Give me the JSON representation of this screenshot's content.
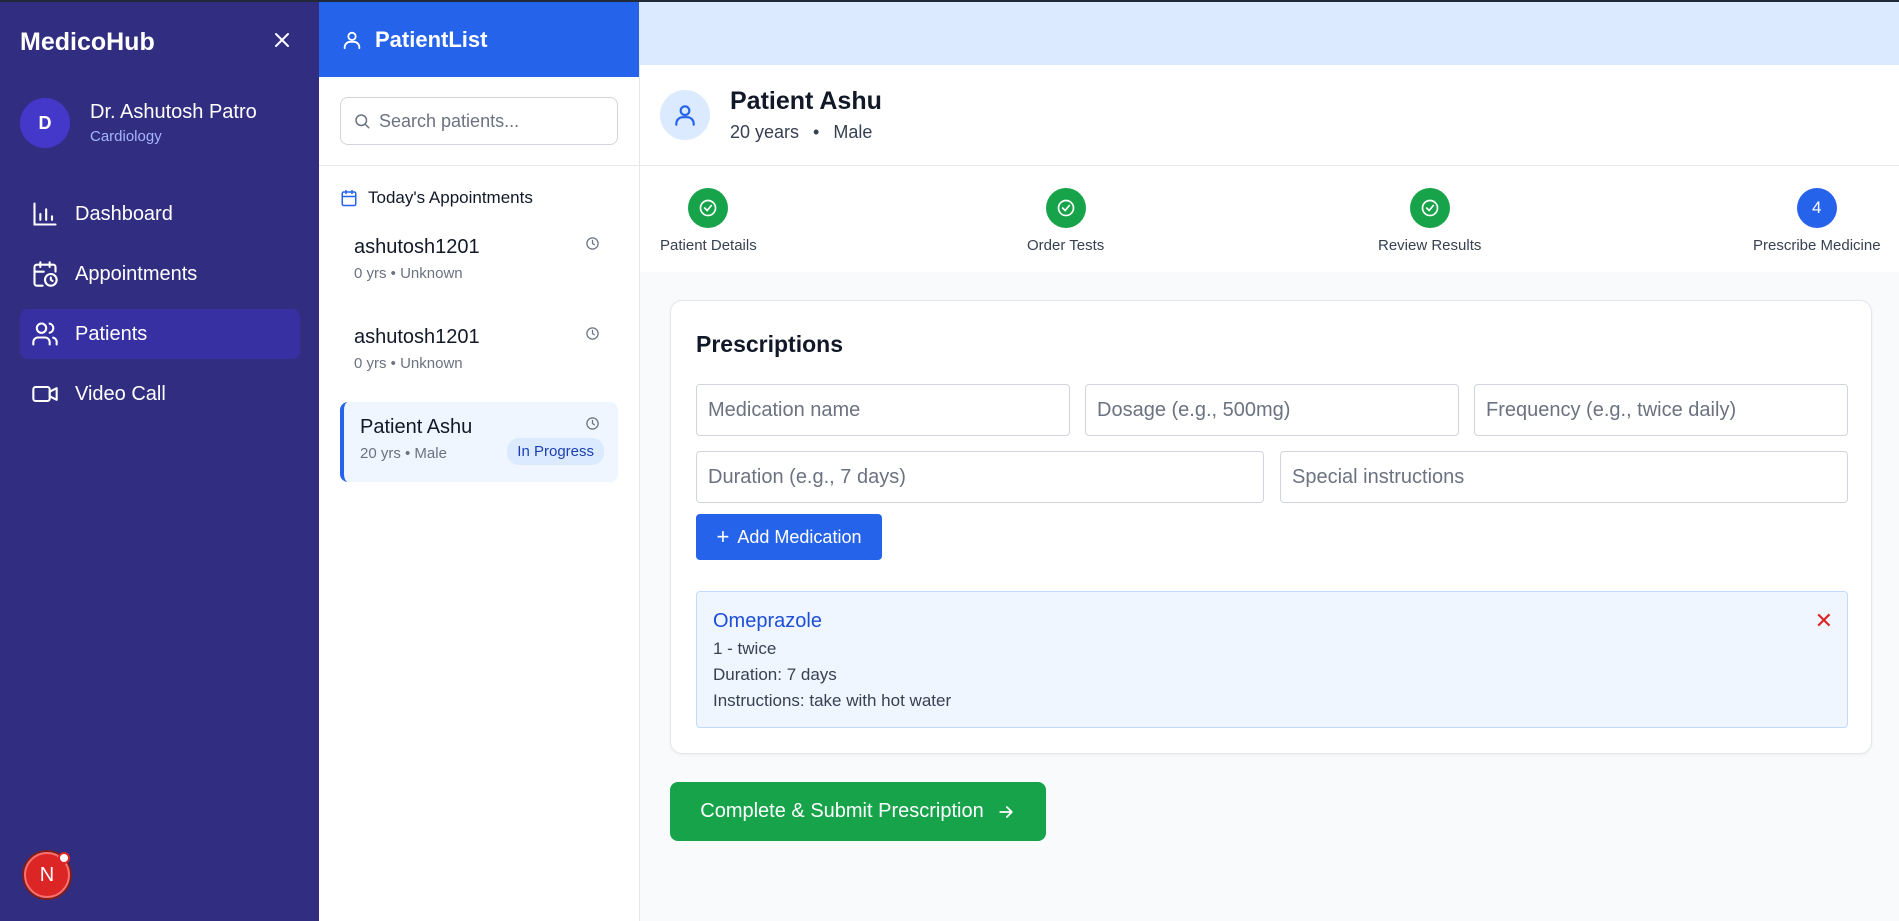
{
  "app": {
    "brand": "MedicoHub"
  },
  "profile": {
    "initial": "D",
    "name": "Dr. Ashutosh Patro",
    "department": "Cardiology"
  },
  "nav": [
    {
      "label": "Dashboard",
      "icon": "bar-chart-icon",
      "active": false
    },
    {
      "label": "Appointments",
      "icon": "calendar-clock-icon",
      "active": false
    },
    {
      "label": "Patients",
      "icon": "users-icon",
      "active": true
    },
    {
      "label": "Video Call",
      "icon": "video-icon",
      "active": false
    }
  ],
  "notification_badge": {
    "letter": "N"
  },
  "patient_list": {
    "title": "PatientList",
    "search_placeholder": "Search patients...",
    "appointments_heading": "Today's Appointments",
    "patients": [
      {
        "name": "ashutosh1201",
        "meta": "0 yrs • Unknown",
        "status": ""
      },
      {
        "name": "ashutosh1201",
        "meta": "0 yrs • Unknown",
        "status": ""
      },
      {
        "name": "Patient Ashu",
        "meta": "20 yrs • Male",
        "status": "In Progress"
      }
    ]
  },
  "patient_header": {
    "name": "Patient Ashu",
    "age": "20 years",
    "separator": "•",
    "gender": "Male"
  },
  "steps": [
    {
      "label": "Patient Details",
      "state": "done"
    },
    {
      "label": "Order Tests",
      "state": "done"
    },
    {
      "label": "Review Results",
      "state": "done"
    },
    {
      "label": "Prescribe Medicine",
      "state": "current",
      "number": "4"
    }
  ],
  "prescriptions": {
    "title": "Prescriptions",
    "placeholders": {
      "medication": "Medication name",
      "dosage": "Dosage (e.g., 500mg)",
      "frequency": "Frequency (e.g., twice daily)",
      "duration": "Duration (e.g., 7 days)",
      "instructions": "Special instructions"
    },
    "add_button": "Add Medication",
    "add_icon": "+",
    "items": [
      {
        "name": "Omeprazole",
        "dose_freq": "1 - twice",
        "duration": "Duration: 7 days",
        "instructions": "Instructions: take with hot water",
        "remove_icon": "✕"
      }
    ]
  },
  "submit_button": "Complete & Submit Prescription",
  "colors": {
    "sidebar": "#312e81",
    "primary": "#2563eb",
    "success": "#16a34a",
    "danger": "#dc2626"
  }
}
